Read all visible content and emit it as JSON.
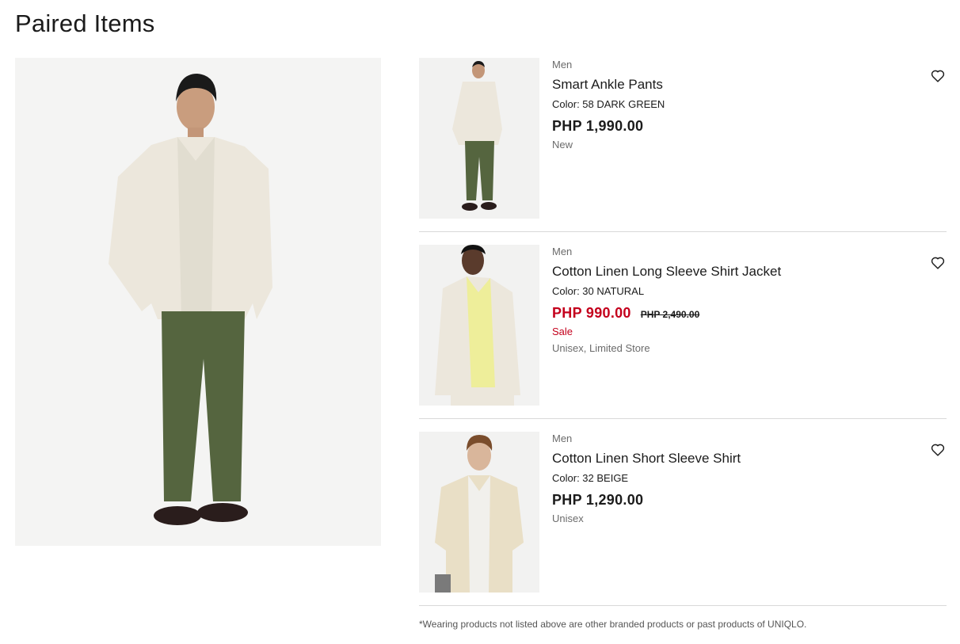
{
  "page": {
    "title": "Paired Items",
    "footnote": "*Wearing products not listed above are other branded products or past products of UNIQLO."
  },
  "colors": {
    "sale": "#c4001c",
    "text": "#1b1b1b",
    "muted": "#6b6b6b",
    "divider": "#d9d9d9"
  },
  "main_image": {
    "alt_icon": "model-photo"
  },
  "products": [
    {
      "gender": "Men",
      "name": "Smart Ankle Pants",
      "color": "Color: 58 DARK GREEN",
      "price": "PHP  1,990.00",
      "old_price": "",
      "tag": "New",
      "sub_tag": "",
      "wishlist_icon": "heart-icon"
    },
    {
      "gender": "Men",
      "name": "Cotton Linen Long Sleeve Shirt Jacket",
      "color": "Color: 30 NATURAL",
      "price": "PHP  990.00",
      "old_price": "PHP  2,490.00",
      "tag": "Sale",
      "sub_tag": "Unisex, Limited Store",
      "wishlist_icon": "heart-icon"
    },
    {
      "gender": "Men",
      "name": "Cotton Linen Short Sleeve Shirt",
      "color": "Color: 32 BEIGE",
      "price": "PHP  1,290.00",
      "old_price": "",
      "tag": "Unisex",
      "sub_tag": "",
      "wishlist_icon": "heart-icon"
    }
  ]
}
